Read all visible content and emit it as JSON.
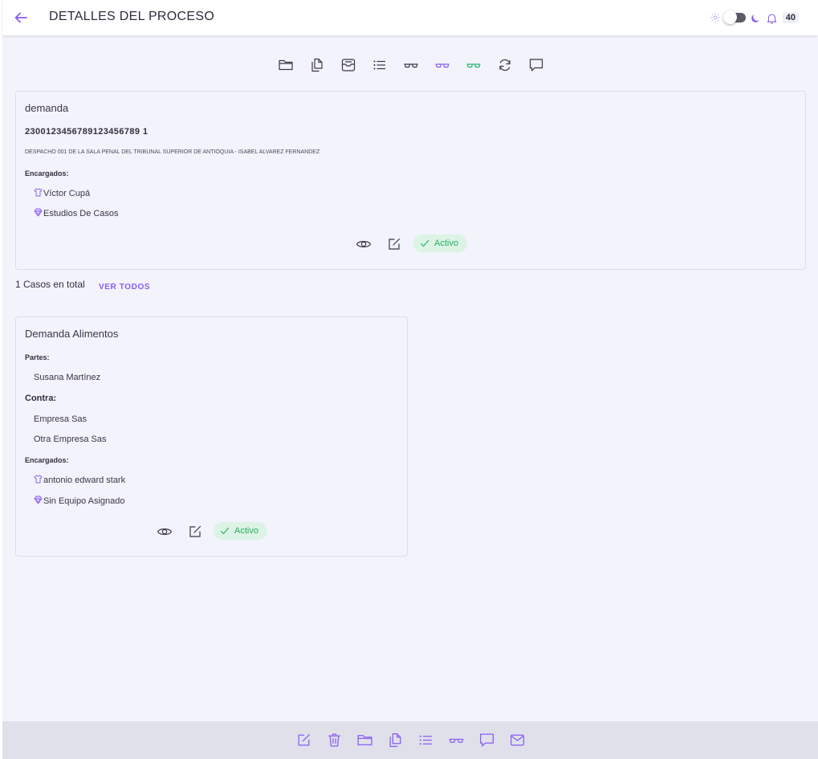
{
  "header": {
    "title": "DETALLES DEL PROCESO",
    "notification_count": "40",
    "theme_toggle": "off",
    "icons": [
      "arrow-left-icon",
      "sun-icon",
      "moon-icon",
      "bell-icon"
    ]
  },
  "toolbar": {
    "icons": [
      "folder-icon",
      "documents-icon",
      "archive-icon",
      "list-icon",
      "glasses-icon",
      "glasses-purple-icon",
      "glasses-green-icon",
      "refresh-icon",
      "comment-icon"
    ]
  },
  "process": {
    "type": "demanda",
    "radicado": "2300123456789123456789 1",
    "despacho": "DESPACHO 001 DE LA SALA PENAL DEL TRIBUNAL SUPERIOR DE ANTIOQUIA - ISABEL ALVAREZ FERNANDEZ",
    "encargados_label": "Encargados:",
    "encargados": [
      {
        "icon": "shirt-icon",
        "name": "Víctor Cupá"
      },
      {
        "icon": "diamond-icon",
        "name": "Estudios De Casos"
      }
    ],
    "status": "Activo"
  },
  "cases_summary": {
    "total_text": "1 Casos en total",
    "link": "VER TODOS"
  },
  "case": {
    "title": "Demanda Alimentos",
    "partes_label": "Partes:",
    "partes": [
      "Susana Martínez"
    ],
    "contra_label": "Contra:",
    "contra": [
      "Empresa Sas",
      "Otra Empresa Sas"
    ],
    "encargados_label": "Encargados:",
    "encargados": [
      {
        "icon": "shirt-icon",
        "name": "antonio edward stark"
      },
      {
        "icon": "diamond-icon",
        "name": "Sin Equipo Asignado"
      }
    ],
    "status": "Activo"
  },
  "bottom_bar": {
    "icons": [
      "edit-icon",
      "trash-icon",
      "folder-icon",
      "documents-icon",
      "list-icon",
      "glasses-icon",
      "comment-icon",
      "mail-icon"
    ]
  },
  "colors": {
    "accent": "#8b5cf6",
    "status_green": "#27ae60",
    "status_bg": "#dcf3e5",
    "background": "#f2f3fb",
    "bottom_bar": "#dfe0ea"
  }
}
